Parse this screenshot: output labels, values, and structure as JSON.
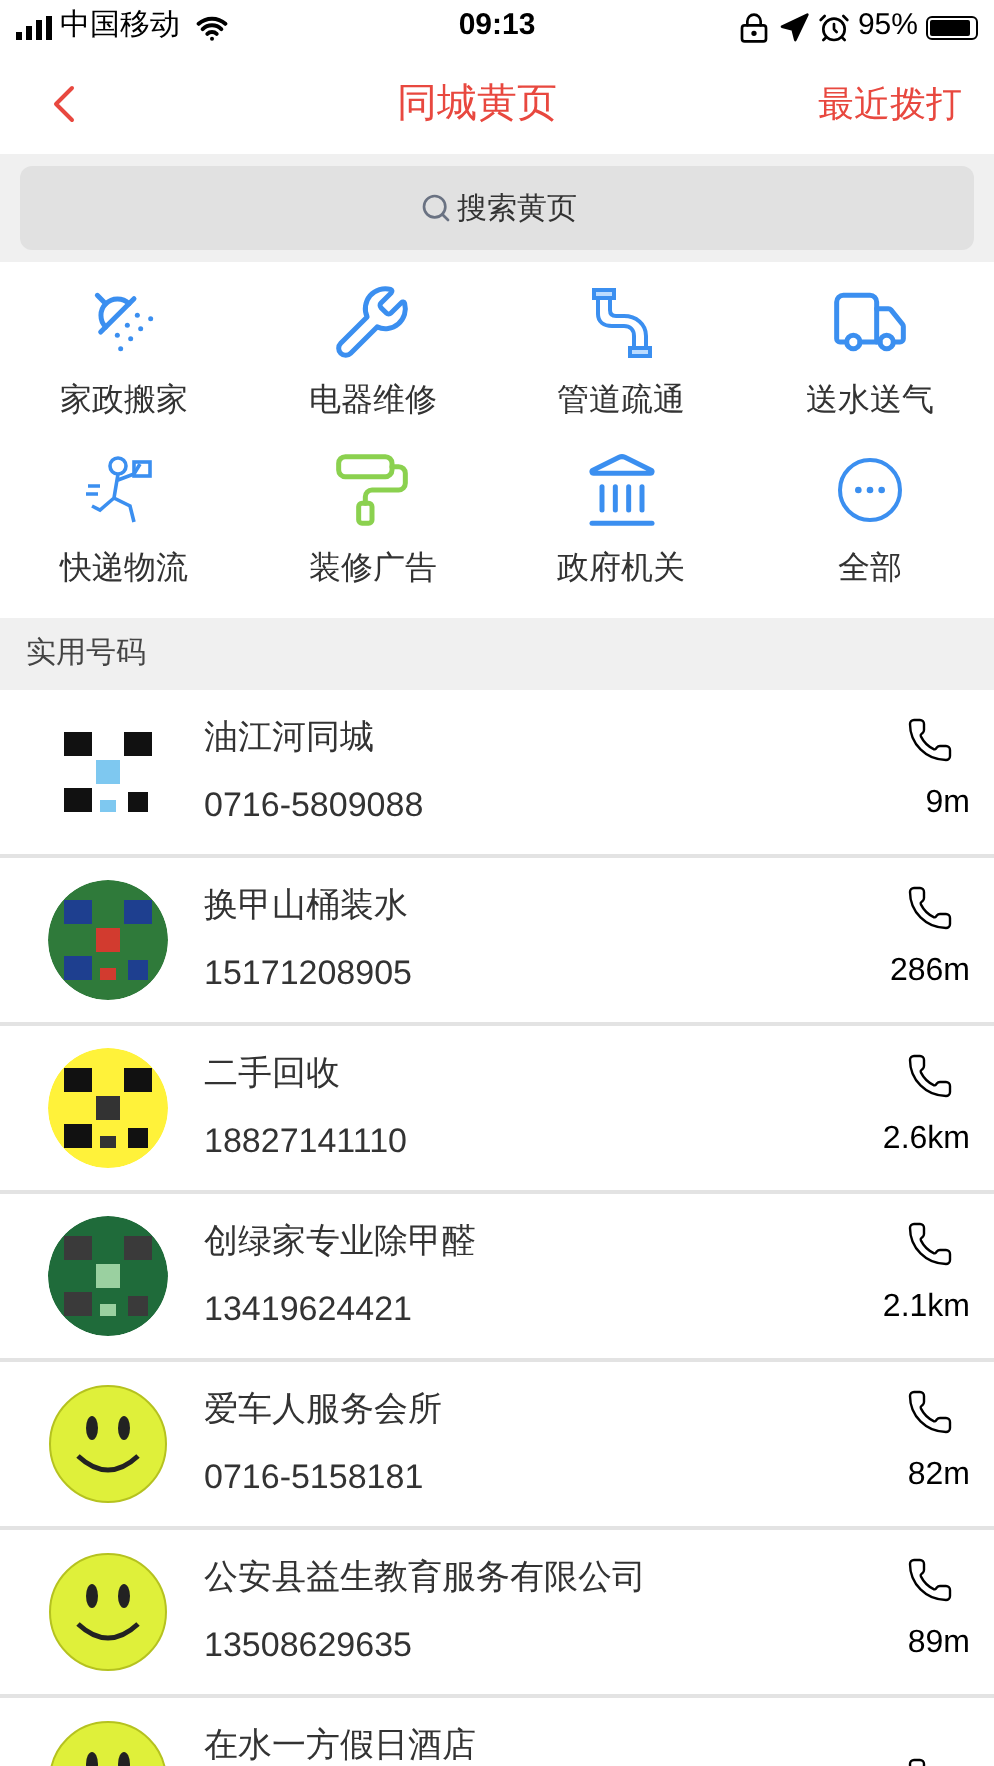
{
  "status_bar": {
    "carrier": "中国移动",
    "time": "09:13",
    "battery": "95%"
  },
  "nav": {
    "title": "同城黄页",
    "action": "最近拨打"
  },
  "search": {
    "placeholder": "搜索黄页"
  },
  "categories": [
    {
      "label": "家政搬家"
    },
    {
      "label": "电器维修"
    },
    {
      "label": "管道疏通"
    },
    {
      "label": "送水送气"
    },
    {
      "label": "快递物流"
    },
    {
      "label": "装修广告"
    },
    {
      "label": "政府机关"
    },
    {
      "label": "全部"
    }
  ],
  "section": {
    "title": "实用号码"
  },
  "contacts": [
    {
      "kind": "picture",
      "name": "油江河同城",
      "phone": "0716-5809088",
      "distance": "9m"
    },
    {
      "kind": "picture",
      "name": "换甲山桶装水",
      "phone": "15171208905",
      "distance": "286m"
    },
    {
      "kind": "picture",
      "name": "二手回收",
      "phone": "18827141110",
      "distance": "2.6km"
    },
    {
      "kind": "picture",
      "name": "创绿家专业除甲醛",
      "phone": "13419624421",
      "distance": "2.1km"
    },
    {
      "kind": "smiley",
      "name": "爱车人服务会所",
      "phone": "0716-5158181",
      "distance": "82m"
    },
    {
      "kind": "smiley",
      "name": "公安县益生教育服务有限公司",
      "phone": "13508629635",
      "distance": "89m"
    },
    {
      "kind": "smiley",
      "name": "在水一方假日酒店"
    }
  ]
}
